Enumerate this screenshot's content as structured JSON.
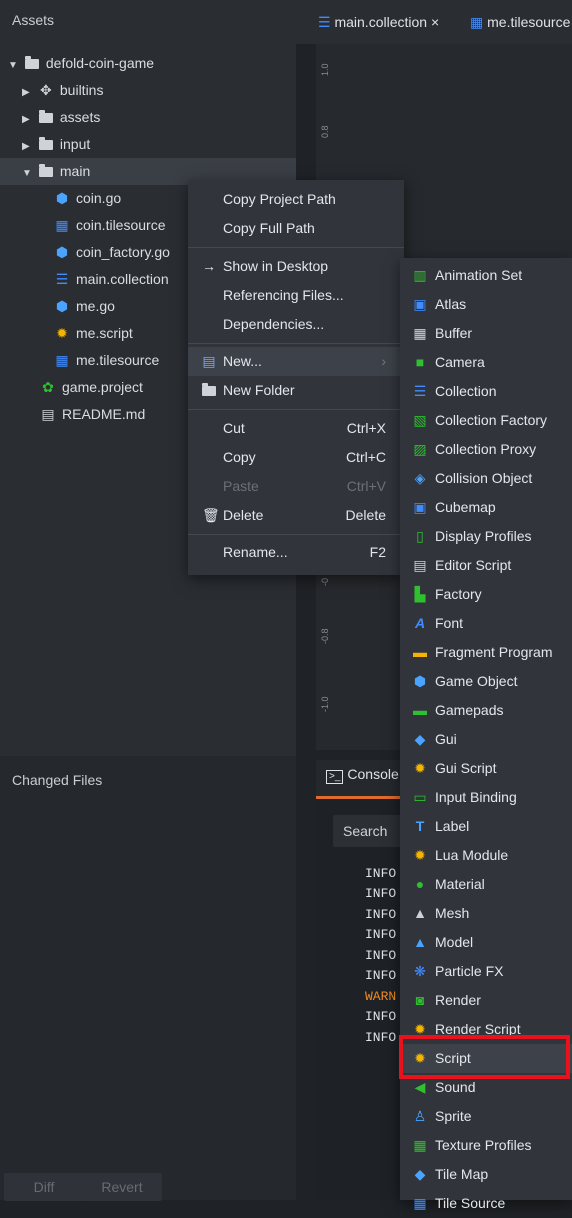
{
  "assets": {
    "title": "Assets",
    "tree": [
      {
        "label": "defold-coin-game",
        "icon": "folder-icon",
        "expanded": true
      },
      {
        "label": "builtins",
        "icon": "puzzle-icon",
        "expanded": false
      },
      {
        "label": "assets",
        "icon": "folder-icon",
        "expanded": false
      },
      {
        "label": "input",
        "icon": "folder-icon",
        "expanded": false
      },
      {
        "label": "main",
        "icon": "folder-icon",
        "expanded": true
      },
      {
        "label": "coin.go",
        "icon": "game-object-icon"
      },
      {
        "label": "coin.tilesource",
        "icon": "tilesource-icon"
      },
      {
        "label": "coin_factory.go",
        "icon": "game-object-icon"
      },
      {
        "label": "main.collection",
        "icon": "collection-icon"
      },
      {
        "label": "me.go",
        "icon": "game-object-icon"
      },
      {
        "label": "me.script",
        "icon": "script-icon"
      },
      {
        "label": "me.tilesource",
        "icon": "tilesource-icon"
      },
      {
        "label": "game.project",
        "icon": "game-project-icon"
      },
      {
        "label": "README.md",
        "icon": "document-icon"
      }
    ]
  },
  "changed_files": {
    "title": "Changed Files",
    "diff_label": "Diff",
    "revert_label": "Revert"
  },
  "editor": {
    "tabs": [
      {
        "label": "main.collection",
        "icon": "collection-icon",
        "close": "×"
      },
      {
        "label": "me.tilesource",
        "icon": "tilesource-icon"
      }
    ],
    "ticks": [
      "1.0",
      "0.8",
      "-0",
      "-0.8",
      "-1.0"
    ]
  },
  "console": {
    "tab_label": "Console",
    "search_label": "Search",
    "lines": [
      "INFO",
      "INFO",
      "INFO",
      "INFO",
      "INFO",
      "INFO",
      "WARN",
      "INFO",
      "INFO"
    ]
  },
  "context_menu": {
    "items": [
      {
        "label": "Copy Project Path",
        "shortcut": ""
      },
      {
        "label": "Copy Full Path",
        "shortcut": ""
      },
      {
        "label": "Show in Desktop",
        "shortcut": "",
        "icon": "arrow-right-icon"
      },
      {
        "label": "Referencing Files...",
        "shortcut": ""
      },
      {
        "label": "Dependencies...",
        "shortcut": ""
      },
      {
        "label": "New...",
        "shortcut": "",
        "icon": "new-file-icon"
      },
      {
        "label": "New Folder",
        "shortcut": "",
        "icon": "folder-icon"
      },
      {
        "label": "Cut",
        "shortcut": "Ctrl+X"
      },
      {
        "label": "Copy",
        "shortcut": "Ctrl+C"
      },
      {
        "label": "Paste",
        "shortcut": "Ctrl+V"
      },
      {
        "label": "Delete",
        "shortcut": "Delete",
        "icon": "trash-icon"
      },
      {
        "label": "Rename...",
        "shortcut": "F2"
      }
    ]
  },
  "submenu": {
    "items": [
      "Animation Set",
      "Atlas",
      "Buffer",
      "Camera",
      "Collection",
      "Collection Factory",
      "Collection Proxy",
      "Collision Object",
      "Cubemap",
      "Display Profiles",
      "Editor Script",
      "Factory",
      "Font",
      "Fragment Program",
      "Game Object",
      "Gamepads",
      "Gui",
      "Gui Script",
      "Input Binding",
      "Label",
      "Lua Module",
      "Material",
      "Mesh",
      "Model",
      "Particle FX",
      "Render",
      "Render Script",
      "Script",
      "Sound",
      "Sprite",
      "Texture Profiles",
      "Tile Map",
      "Tile Source"
    ],
    "highlighted": "Script"
  },
  "colors": {
    "accent_orange": "#e06b2d",
    "highlight_red": "#e8121c",
    "warn": "#f08a24"
  }
}
